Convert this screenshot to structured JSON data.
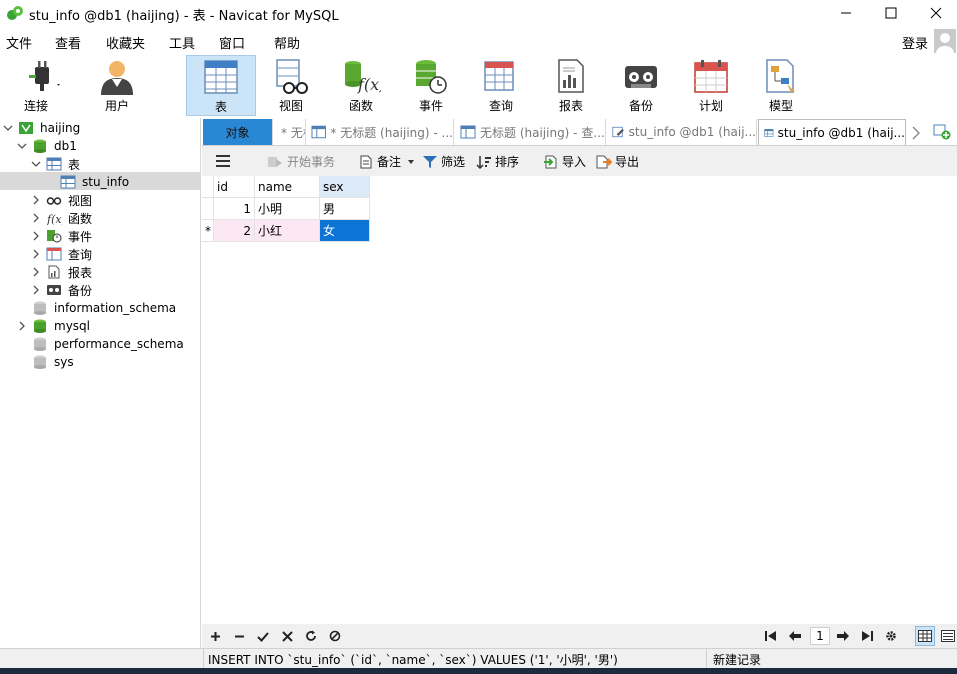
{
  "window": {
    "title": "stu_info @db1 (haijing) - 表 - Navicat for MySQL"
  },
  "menu": [
    "文件",
    "查看",
    "收藏夹",
    "工具",
    "窗口",
    "帮助"
  ],
  "login_label": "登录",
  "toolbar": [
    {
      "label": "连接",
      "icon": "plug-icon"
    },
    {
      "label": "用户",
      "icon": "user-icon"
    },
    {
      "label": "表",
      "icon": "table-icon",
      "active": true
    },
    {
      "label": "视图",
      "icon": "view-glasses-icon"
    },
    {
      "label": "函数",
      "icon": "function-icon"
    },
    {
      "label": "事件",
      "icon": "event-clock-icon"
    },
    {
      "label": "查询",
      "icon": "query-icon"
    },
    {
      "label": "报表",
      "icon": "report-icon"
    },
    {
      "label": "备份",
      "icon": "backup-icon"
    },
    {
      "label": "计划",
      "icon": "calendar-icon"
    },
    {
      "label": "模型",
      "icon": "model-icon"
    }
  ],
  "tree": {
    "connection": "haijing",
    "database": "db1",
    "tables_node": "表",
    "table": "stu_info",
    "groups": [
      "视图",
      "函数",
      "事件",
      "查询",
      "报表",
      "备份"
    ],
    "other_dbs": [
      "information_schema",
      "mysql",
      "performance_schema",
      "sys"
    ]
  },
  "tabs": {
    "objects": "对象",
    "items": [
      "* 无标题 (haijing) - ...",
      "* 无标题 (haijing) - ...",
      "无标题 (haijing) - 查...",
      "stu_info @db1 (haij...",
      "stu_info @db1 (haij..."
    ]
  },
  "grid_toolbar": {
    "begin_transaction": "开始事务",
    "memo": "备注",
    "filter": "筛选",
    "sort": "排序",
    "import": "导入",
    "export": "导出"
  },
  "table": {
    "columns": [
      "id",
      "name",
      "sex"
    ],
    "rows": [
      {
        "marker": "",
        "id": "1",
        "name": "小明",
        "sex": "男"
      },
      {
        "marker": "*",
        "id": "2",
        "name": "小红",
        "sex": "女"
      }
    ]
  },
  "pager": {
    "page": "1"
  },
  "status": {
    "sql": "INSERT INTO `stu_info` (`id`, `name`, `sex`) VALUES ('1', '小明', '男')",
    "record": "新建记录"
  },
  "colors": {
    "accent": "#2a87d4",
    "selected_cell": "#0b74d5",
    "active_tool": "#cce4f7"
  }
}
